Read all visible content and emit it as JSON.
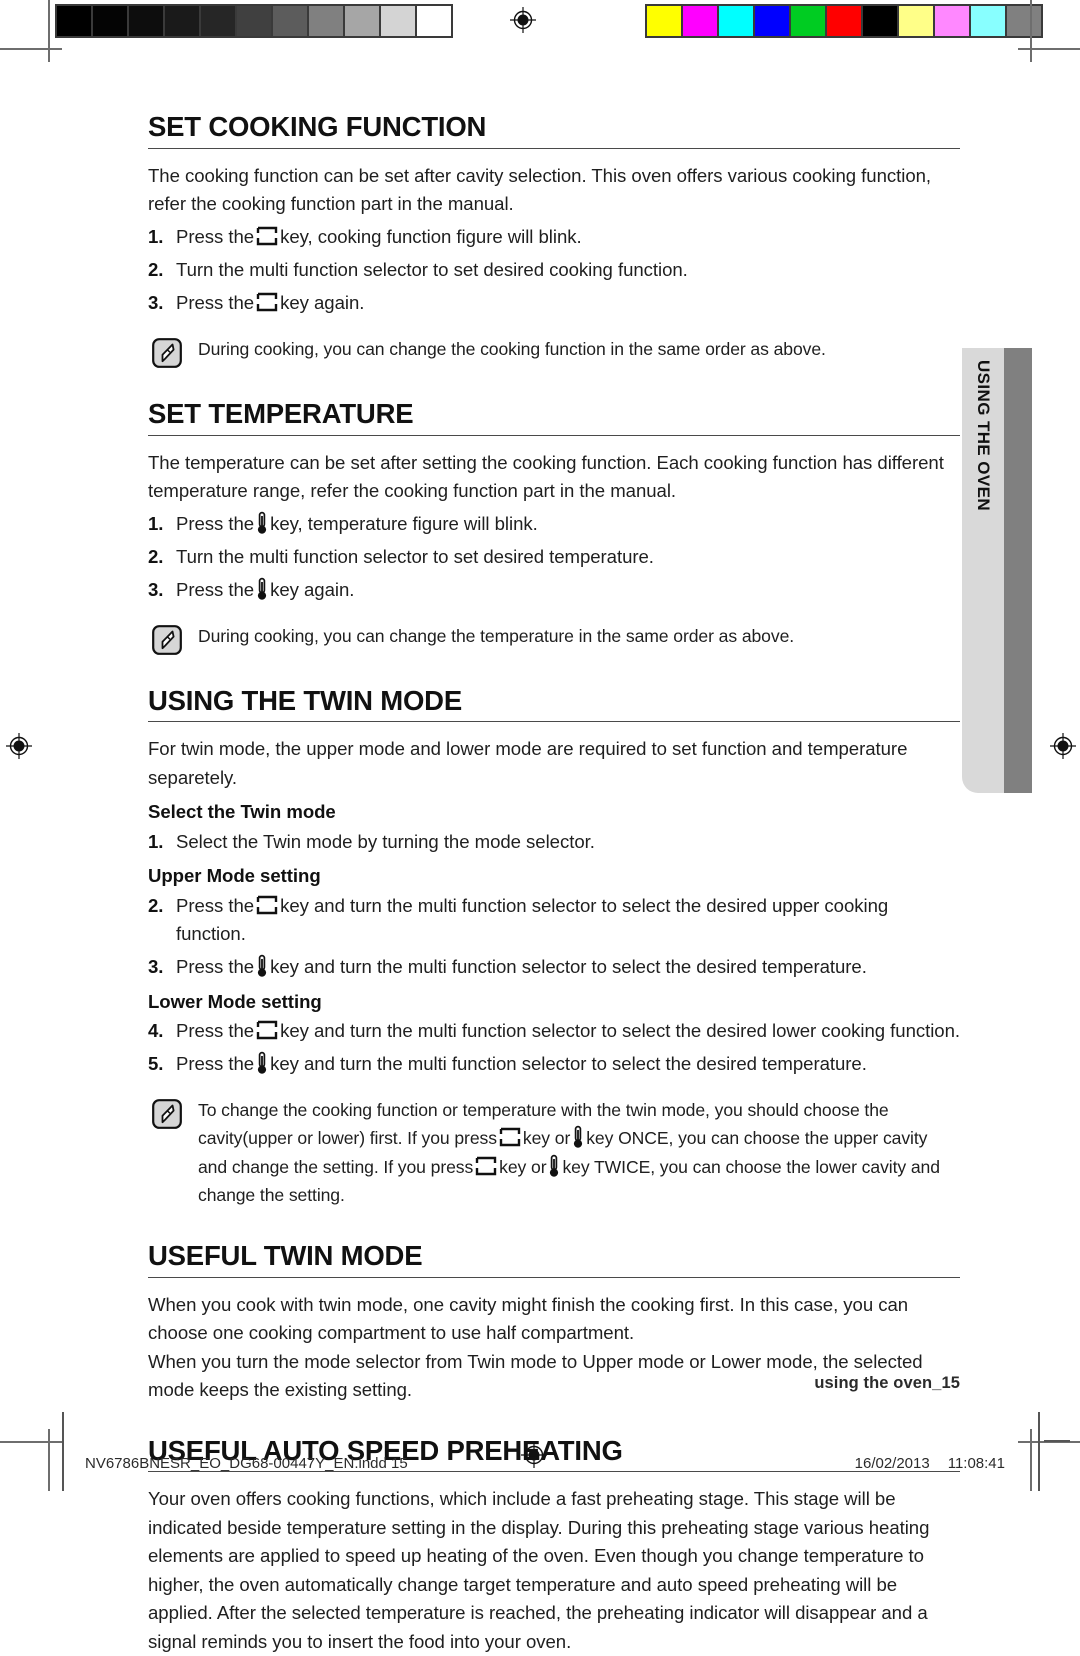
{
  "calibration": {
    "gray_patches": [
      "#000000",
      "#040404",
      "#0d0d0d",
      "#1a1a1a",
      "#262626",
      "#404040",
      "#5c5c5c",
      "#808080",
      "#a6a6a6",
      "#d4d4d4",
      "#ffffff"
    ],
    "color_patches": [
      "#ffff00",
      "#ff00ff",
      "#00ffff",
      "#0000ff",
      "#00cc22",
      "#ff0000",
      "#000000",
      "#ffff88",
      "#ff88ff",
      "#88ffff",
      "#808080"
    ]
  },
  "side_tab": {
    "label": "USING THE OVEN",
    "tab_color": "#d9d9d9",
    "stripe_color": "#808080"
  },
  "sections": [
    {
      "id": "set-cooking-function",
      "title": "SET COOKING FUNCTION",
      "intro": "The cooking function can be set after cavity selection. This oven offers various cooking function, refer the cooking function part in the manual.",
      "steps": [
        {
          "num": "1.",
          "pre": "Press the",
          "icon": "function-key-icon",
          "post": "key, cooking function figure will blink."
        },
        {
          "num": "2.",
          "pre": "Turn the multi function selector to set desired cooking function.",
          "icon": "",
          "post": ""
        },
        {
          "num": "3.",
          "pre": "Press the",
          "icon": "function-key-icon",
          "post": "key again."
        }
      ],
      "note": "During cooking, you can change the cooking function in the same order as above."
    },
    {
      "id": "set-temperature",
      "title": "SET TEMPERATURE",
      "intro": "The temperature can be set after setting the cooking function. Each cooking function has different temperature range, refer the cooking function part in the manual.",
      "steps": [
        {
          "num": "1.",
          "pre": "Press the",
          "icon": "temperature-key-icon",
          "post": "key, temperature figure will blink."
        },
        {
          "num": "2.",
          "pre": "Turn the multi function selector to set desired temperature.",
          "icon": "",
          "post": ""
        },
        {
          "num": "3.",
          "pre": "Press the",
          "icon": "temperature-key-icon",
          "post": "key again."
        }
      ],
      "note": "During cooking, you can change the temperature in the same order as above."
    },
    {
      "id": "using-the-twin-mode",
      "title": "USING THE TWIN MODE",
      "intro": "For twin mode, the upper mode and lower mode are required to set function and temperature separetely.",
      "subhead_1": "Select the Twin mode",
      "subhead_2": "Upper Mode setting",
      "subhead_3": "Lower Mode setting",
      "step_1": {
        "num": "1.",
        "pre": "Select the Twin mode by turning the mode selector.",
        "icon": "",
        "post": ""
      },
      "step_2": {
        "num": "2.",
        "pre": "Press the",
        "icon": "function-key-icon",
        "post": "key and turn the multi function selector to select the desired upper cooking function."
      },
      "step_3": {
        "num": "3.",
        "pre": "Press the",
        "icon": "temperature-key-icon",
        "post": "key and turn the multi function selector to select the desired temperature."
      },
      "step_4": {
        "num": "4.",
        "pre": "Press the",
        "icon": "function-key-icon",
        "post": "key and turn the multi function selector to select the desired lower cooking function."
      },
      "step_5": {
        "num": "5.",
        "pre": "Press the",
        "icon": "temperature-key-icon",
        "post": "key and turn the multi function selector to select the desired temperature."
      },
      "note_part_1": "To change the cooking function or temperature with the twin mode, you should choose the cavity(upper or lower) first. If you press",
      "note_part_2": "key or",
      "note_part_3": "key ONCE, you can choose the upper cavity and change the setting. If you press",
      "note_part_4": "key or",
      "note_part_5": "key TWICE, you can choose the lower cavity and change the setting."
    },
    {
      "id": "useful-twin-mode",
      "title": "USEFUL TWIN MODE",
      "para_1": "When you cook with twin mode, one cavity might finish the cooking first. In this case, you can choose one cooking compartment to use half compartment.",
      "para_2": "When you turn the mode selector from Twin mode to Upper mode or Lower mode, the selected mode keeps the existing setting."
    },
    {
      "id": "useful-auto-speed-preheating",
      "title": "USEFUL AUTO SPEED PREHEATING",
      "para_1": "Your oven offers cooking functions, which include a fast preheating stage. This stage will be indicated beside temperature setting in the display. During this preheating stage various heating elements are applied to speed up heating of the oven. Even though you change temperature to higher, the oven automatically change target temperature and auto speed preheating will be applied. After the selected temperature is reached, the preheating indicator will disappear and a signal reminds you to insert the food into your oven."
    }
  ],
  "running_foot": "using the oven_15",
  "imprint": {
    "file": "NV6786BNESR_EO_DG68-00447Y_EN.indd   15",
    "date": "16/02/2013",
    "time": "11:08:41"
  }
}
